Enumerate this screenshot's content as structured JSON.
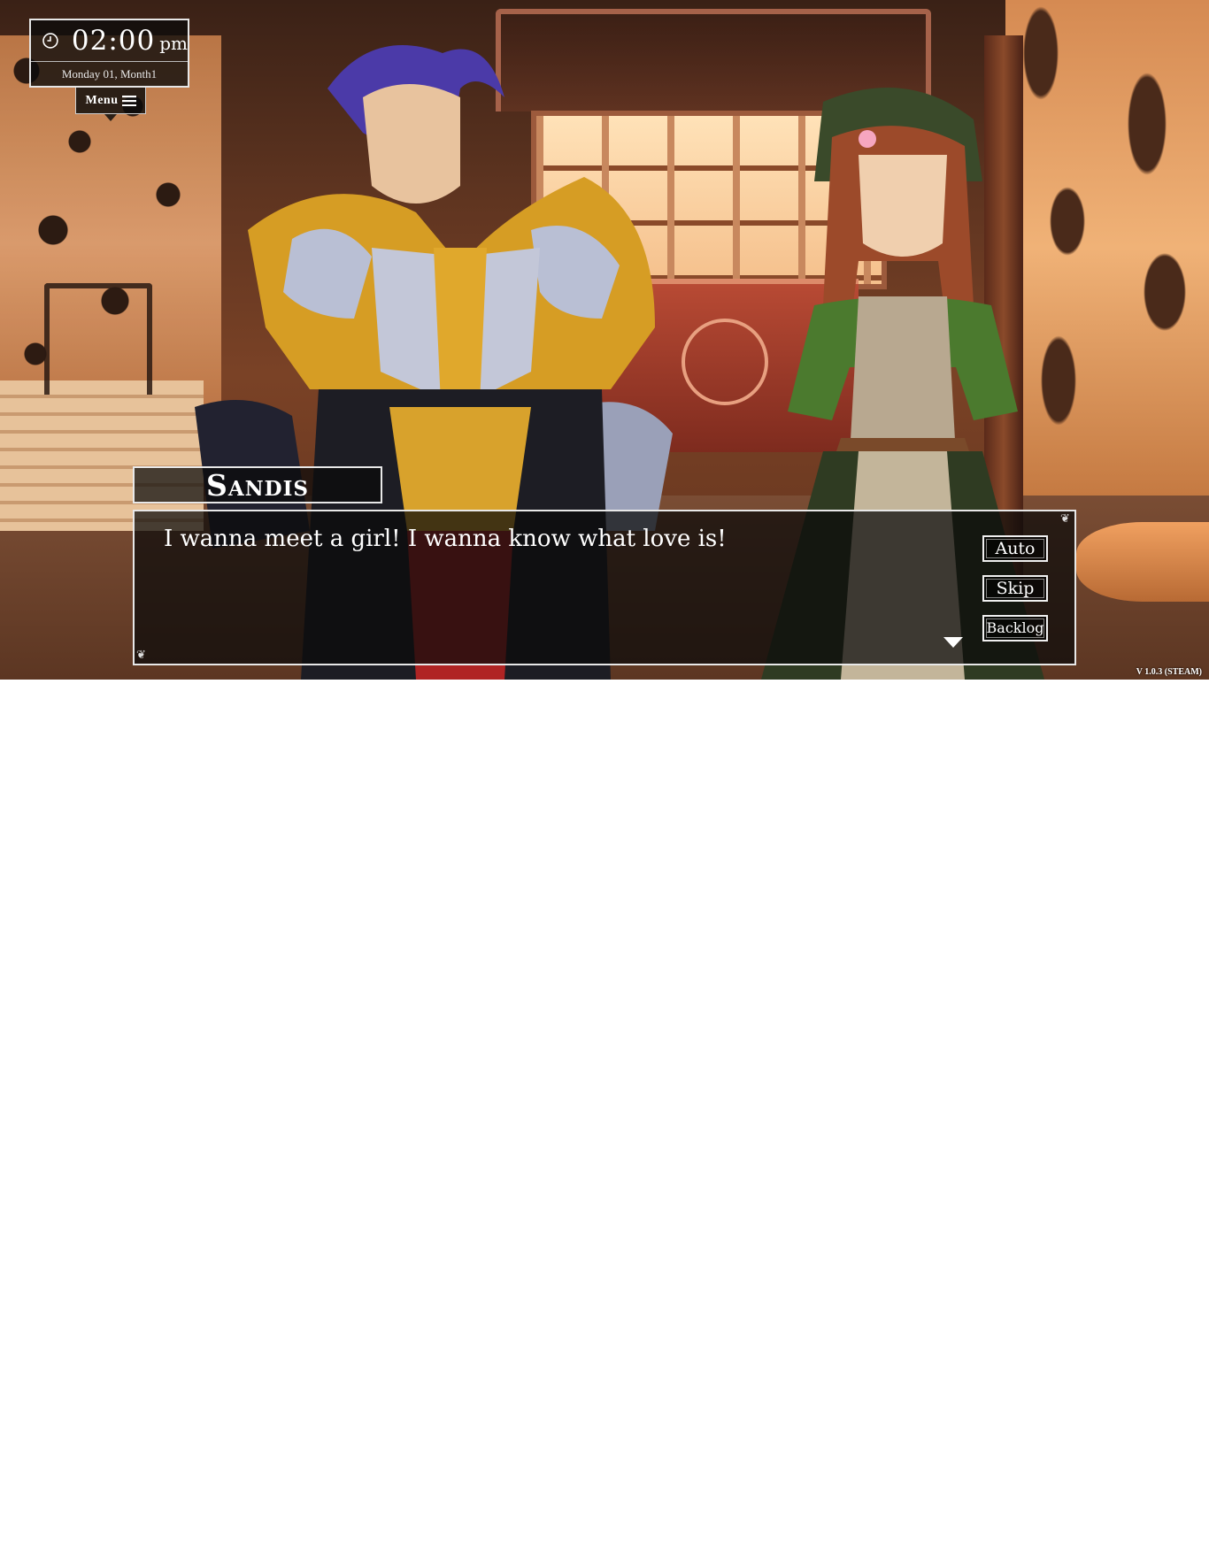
{
  "hud": {
    "time": "02:00",
    "ampm": "pm",
    "date": "Monday 01, Month1",
    "menu_label": "Menu",
    "clock_icon": "clock-icon",
    "menu_icon": "hamburger-icon"
  },
  "dialogue": {
    "speaker": "Sandis",
    "text": "I wanna meet a girl! I wanna know what love is!",
    "advance_icon": "triangle-down-icon"
  },
  "controls": {
    "auto": "Auto",
    "skip": "Skip",
    "backlog": "Backlog"
  },
  "version": "V 1.0.3 (STEAM)",
  "colors": {
    "panel_bg": "#0a0a0a",
    "panel_border": "#e8e8e8",
    "text": "#ffffff"
  }
}
